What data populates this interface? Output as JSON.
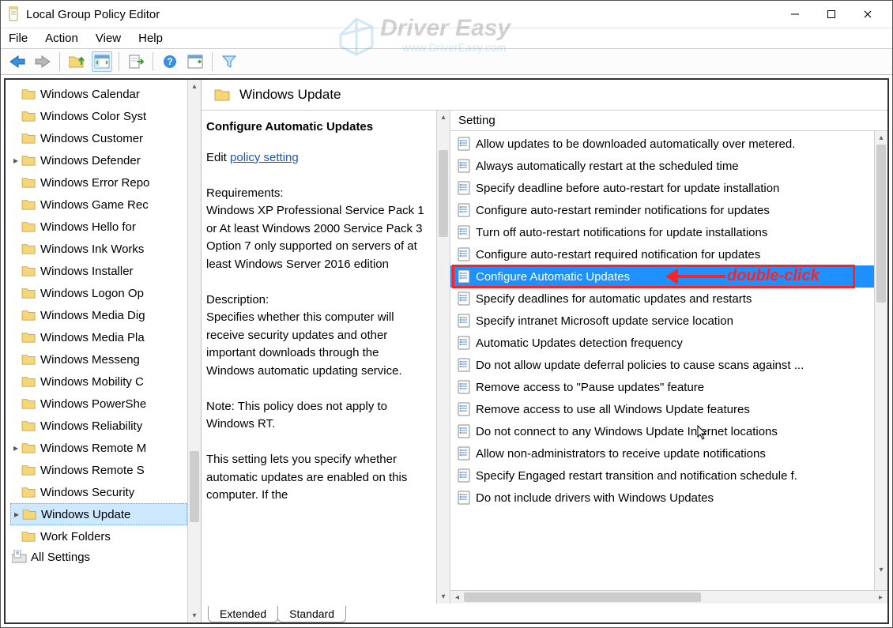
{
  "title": "Local Group Policy Editor",
  "menu": {
    "file": "File",
    "action": "Action",
    "view": "View",
    "help": "Help"
  },
  "window_controls": {
    "min": "—",
    "max": "☐",
    "close": "✕"
  },
  "watermark": {
    "brand": "Driver Easy",
    "url": "www.DriverEasy.com"
  },
  "tree": {
    "items": [
      {
        "label": "Windows Calendar",
        "expandable": false
      },
      {
        "label": "Windows Color Syst",
        "expandable": false
      },
      {
        "label": "Windows Customer",
        "expandable": false
      },
      {
        "label": "Windows Defender",
        "expandable": true
      },
      {
        "label": "Windows Error Repo",
        "expandable": false
      },
      {
        "label": "Windows Game Rec",
        "expandable": false
      },
      {
        "label": "Windows Hello for",
        "expandable": false
      },
      {
        "label": "Windows Ink Works",
        "expandable": false
      },
      {
        "label": "Windows Installer",
        "expandable": false
      },
      {
        "label": "Windows Logon Op",
        "expandable": false
      },
      {
        "label": "Windows Media Dig",
        "expandable": false
      },
      {
        "label": "Windows Media Pla",
        "expandable": false
      },
      {
        "label": "Windows Messeng",
        "expandable": false
      },
      {
        "label": "Windows Mobility C",
        "expandable": false
      },
      {
        "label": "Windows PowerShe",
        "expandable": false
      },
      {
        "label": "Windows Reliability",
        "expandable": false
      },
      {
        "label": "Windows Remote M",
        "expandable": true
      },
      {
        "label": "Windows Remote S",
        "expandable": false
      },
      {
        "label": "Windows Security",
        "expandable": false
      },
      {
        "label": "Windows Update",
        "expandable": true,
        "selected": true
      },
      {
        "label": "Work Folders",
        "expandable": false
      }
    ],
    "footer": "All Settings"
  },
  "right": {
    "header": "Windows Update",
    "desc": {
      "title": "Configure Automatic Updates",
      "edit_label": "Edit",
      "edit_link": "policy setting",
      "req_head": "Requirements:",
      "req_body": "Windows XP Professional Service Pack 1 or At least Windows 2000 Service Pack 3 Option 7 only supported on servers of at least Windows Server 2016 edition",
      "desc_head": "Description:",
      "desc_body": "Specifies whether this computer will receive security updates and other important downloads through the Windows automatic updating service.",
      "note": "Note: This policy does not apply to Windows RT.",
      "tail": "This setting lets you specify whether automatic updates are enabled on this computer. If the"
    },
    "list": {
      "header": "Setting",
      "items": [
        "Allow updates to be downloaded automatically over metered.",
        "Always automatically restart at the scheduled time",
        "Specify deadline before auto-restart for update installation",
        "Configure auto-restart reminder notifications for updates",
        "Turn off auto-restart notifications for update installations",
        "Configure auto-restart required notification for updates",
        "Configure Automatic Updates",
        "Specify deadlines for automatic updates and restarts",
        "Specify intranet Microsoft update service location",
        "Automatic Updates detection frequency",
        "Do not allow update deferral policies to cause scans against ...",
        "Remove access to \"Pause updates\" feature",
        "Remove access to use all Windows Update features",
        "Do not connect to any Windows Update Internet locations",
        "Allow non-administrators to receive update notifications",
        "Specify Engaged restart transition and notification schedule f.",
        "Do not include drivers with Windows Updates"
      ],
      "selected_index": 6
    }
  },
  "tabs": {
    "extended": "Extended",
    "standard": "Standard"
  },
  "annotation": {
    "label": "double-click"
  }
}
